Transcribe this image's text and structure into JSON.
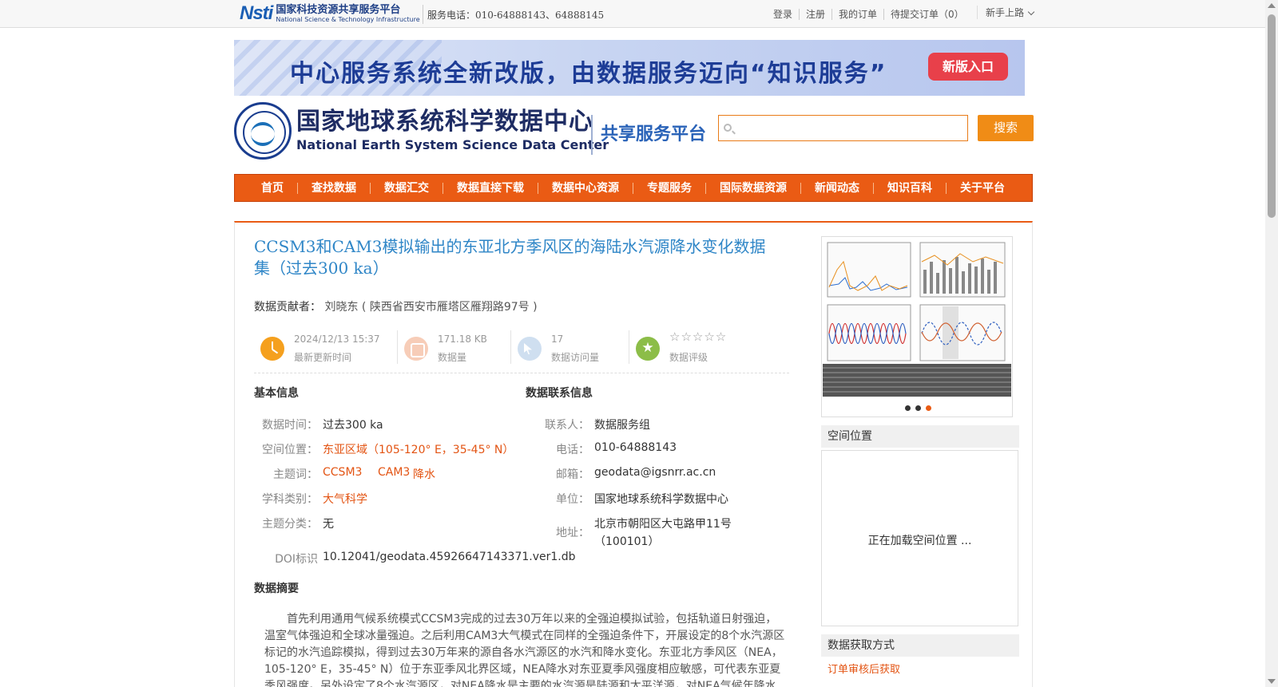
{
  "topbar": {
    "logo_cn": "国家科技资源共享服务平台",
    "logo_en": "National Science & Technology Infrastructure",
    "logo_mark": "Nsti",
    "phone": "服务电话：010-64888143、64888145",
    "links": [
      "登录",
      "注册",
      "我的订单",
      "待提交订单（0）"
    ],
    "guide": "新手上路"
  },
  "banner": {
    "text": "中心服务系统全新改版，由数据服务迈向“知识服务”",
    "button": "新版入口"
  },
  "header": {
    "center_cn": "国家地球系统科学数据中心",
    "center_en": "National Earth System Science Data Center",
    "platform": "共享服务平台",
    "search_placeholder": "",
    "search_button": "搜索"
  },
  "nav": [
    "首页",
    "查找数据",
    "数据汇交",
    "数据直接下载",
    "数据中心资源",
    "专题服务",
    "国际数据资源",
    "新闻动态",
    "知识百科",
    "关于平台"
  ],
  "dataset": {
    "title": "CCSM3和CAM3模拟输出的东亚北方季风区的海陆水汽源降水变化数据集（过去300 ka）",
    "contributor_label": "数据贡献者：",
    "contributor_value": "刘晓东 ( 陕西省西安市雁塔区雁翔路97号 )",
    "stats": {
      "updated_value": "2024/12/13 15:37",
      "updated_label": "最新更新时间",
      "size_value": "171.18 KB",
      "size_label": "数据量",
      "visits_value": "17",
      "visits_label": "数据访问量",
      "rating_stars": "☆☆☆☆☆",
      "rating_value": 0,
      "rating_label": "数据评级"
    }
  },
  "basic_info": {
    "title": "基本信息",
    "time_label": "数据时间：",
    "time_value": "过去300 ka",
    "space_label": "空间位置：",
    "space_value": "东亚区域（105-120° E，35-45° N）",
    "keywords_label": "主题词：",
    "keywords": [
      "CCSM3",
      "CAM3",
      "降水"
    ],
    "discipline_label": "学科类别：",
    "discipline_value": "大气科学",
    "category_label": "主题分类：",
    "category_value": "无",
    "doi_label": "DOI标识",
    "doi_value": "10.12041/geodata.45926647143371.ver1.db"
  },
  "contact_info": {
    "title": "数据联系信息",
    "person_label": "联系人：",
    "person_value": "数据服务组",
    "phone_label": "电话：",
    "phone_value": "010-64888143",
    "email_label": "邮箱：",
    "email_value": "geodata@igsnrr.ac.cn",
    "unit_label": "单位：",
    "unit_value": "国家地球系统科学数据中心",
    "address_label": "地址：",
    "address_line1": "北京市朝阳区大屯路甲11号",
    "address_line2": "（100101）"
  },
  "abstract": {
    "title": "数据摘要",
    "text": "首先利用通用气候系统模式CCSM3完成的过去30万年以来的全强迫模拟试验，包括轨道日射强迫，温室气体强迫和全球冰量强迫。之后利用CAM3大气模式在同样的全强迫条件下，开展设定的8个水汽源区标记的水汽追踪模拟，得到过去30万年来的源自各水汽源区的水汽和降水变化。东亚北方季风区（NEA，105-120° E，35-45° N）位于东亚季风北界区域，NEA降水对东亚夏季风强度相应敏感，可代表东亚夏季风强度。另外设定了8个水汽源区，对NEA降水是主要的水汽源是陆源和太平洋源，对NEA气候年降水分别"
  },
  "sidebar": {
    "carousel_dots": 3,
    "carousel_active": 3,
    "space_title": "空间位置",
    "space_loading": "正在加载空间位置 ...",
    "acquire_title": "数据获取方式",
    "acquire_value": "订单审核后获取"
  },
  "colors": {
    "nav_bg": "#ea5b14",
    "title_blue": "#2f86c7",
    "link_orange": "#e35413",
    "search_btn": "#f08c16"
  }
}
